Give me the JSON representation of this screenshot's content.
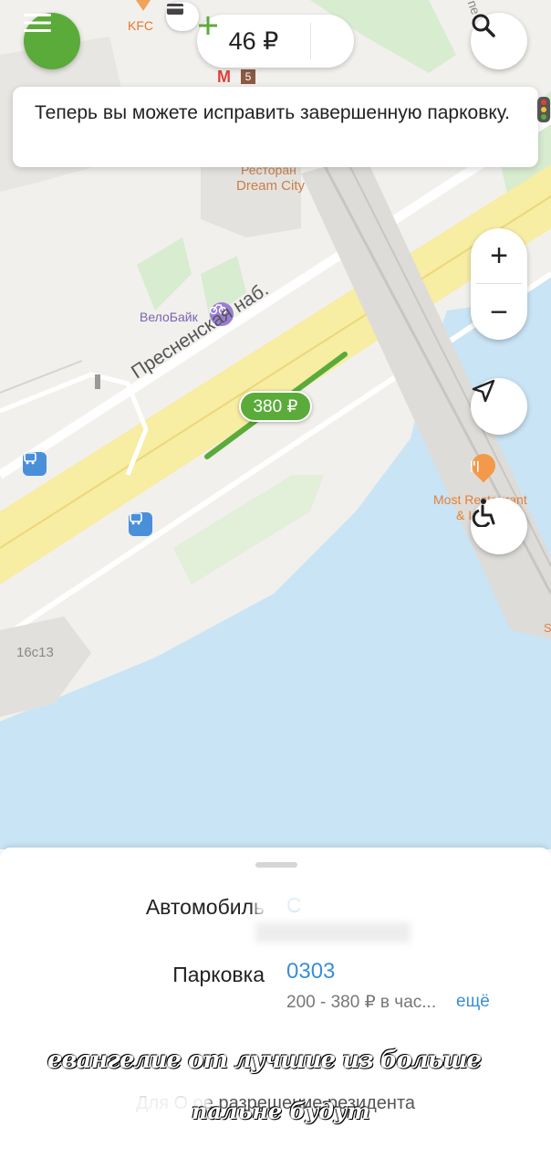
{
  "map": {
    "poi_kfc": "KFC",
    "metro_line": "5",
    "poi_restaurant_line1": "Ресторан",
    "poi_restaurant_line2": "Dream City",
    "poi_velobike": "ВелоБайк",
    "street_name": "Пресненская наб.",
    "street_top": "пе",
    "poi_most_line1": "Most Restaurant",
    "poi_most_line2": "& I",
    "building_label": "16с13",
    "parking_price": "380 ₽",
    "edge_letter": "S"
  },
  "header": {
    "balance": "46 ₽",
    "menu_icon": "menu-icon",
    "search_icon": "search-icon",
    "add_icon": "plus-icon",
    "card_icon": "card-icon"
  },
  "toast": {
    "message": "Теперь вы можете исправить завершенную парковку."
  },
  "controls": {
    "zoom_in": "+",
    "zoom_out": "−"
  },
  "sheet": {
    "car_label": "Автомобиль",
    "car_value": "С",
    "parking_label": "Парковка",
    "parking_zone": "0303",
    "rate": "200 - 380 ₽ в час...",
    "more": "ещё",
    "note": "Для О                    ое разрешение резидента",
    "overlay_line1": "евангелие от лучшие из больше",
    "overlay_line2": "пальне будут"
  },
  "colors": {
    "accent": "#5bab3a",
    "link": "#3a8fd6",
    "water": "#c9e4f5",
    "road": "#f7eda3"
  }
}
